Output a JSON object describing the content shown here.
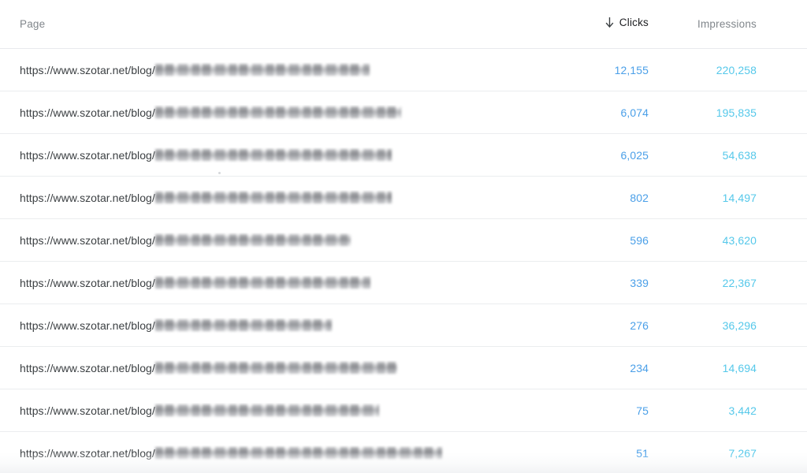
{
  "table": {
    "columns": {
      "page": "Page",
      "clicks": "Clicks",
      "impressions": "Impressions"
    },
    "sort": {
      "column": "Clicks",
      "direction": "descending",
      "icon": "arrow-down-icon"
    },
    "url_prefix": "https://www.szotar.net/blog/",
    "colors": {
      "clicks_value": "#4a9fe8",
      "impressions_value": "#55c8ea",
      "url_text": "#3c4043",
      "header_active": "#202124",
      "header_inactive": "#80868b",
      "row_divider": "#ebedef",
      "background": "#ffffff"
    },
    "rows": [
      {
        "url_prefix": "https://www.szotar.net/blog/",
        "slug_redacted": true,
        "slug_width": 272,
        "clicks": "12,155",
        "impressions": "220,258"
      },
      {
        "url_prefix": "https://www.szotar.net/blog/",
        "slug_redacted": true,
        "slug_width": 312,
        "clicks": "6,074",
        "impressions": "195,835"
      },
      {
        "url_prefix": "https://www.szotar.net/blog/",
        "slug_redacted": true,
        "slug_width": 300,
        "clicks": "6,025",
        "impressions": "54,638"
      },
      {
        "url_prefix": "https://www.szotar.net/blog/",
        "slug_redacted": true,
        "slug_width": 300,
        "clicks": "802",
        "impressions": "14,497"
      },
      {
        "url_prefix": "https://www.szotar.net/blog/",
        "slug_redacted": true,
        "slug_width": 248,
        "clicks": "596",
        "impressions": "43,620"
      },
      {
        "url_prefix": "https://www.szotar.net/blog/",
        "slug_redacted": true,
        "slug_width": 273,
        "clicks": "339",
        "impressions": "22,367"
      },
      {
        "url_prefix": "https://www.szotar.net/blog/",
        "slug_redacted": true,
        "slug_width": 224,
        "clicks": "276",
        "impressions": "36,296"
      },
      {
        "url_prefix": "https://www.szotar.net/blog/",
        "slug_redacted": true,
        "slug_width": 307,
        "clicks": "234",
        "impressions": "14,694"
      },
      {
        "url_prefix": "https://www.szotar.net/blog/",
        "slug_redacted": true,
        "slug_width": 284,
        "clicks": "75",
        "impressions": "3,442"
      },
      {
        "url_prefix": "https://www.szotar.net/blog/",
        "slug_redacted": true,
        "slug_width": 364,
        "clicks": "51",
        "impressions": "7,267"
      }
    ]
  }
}
